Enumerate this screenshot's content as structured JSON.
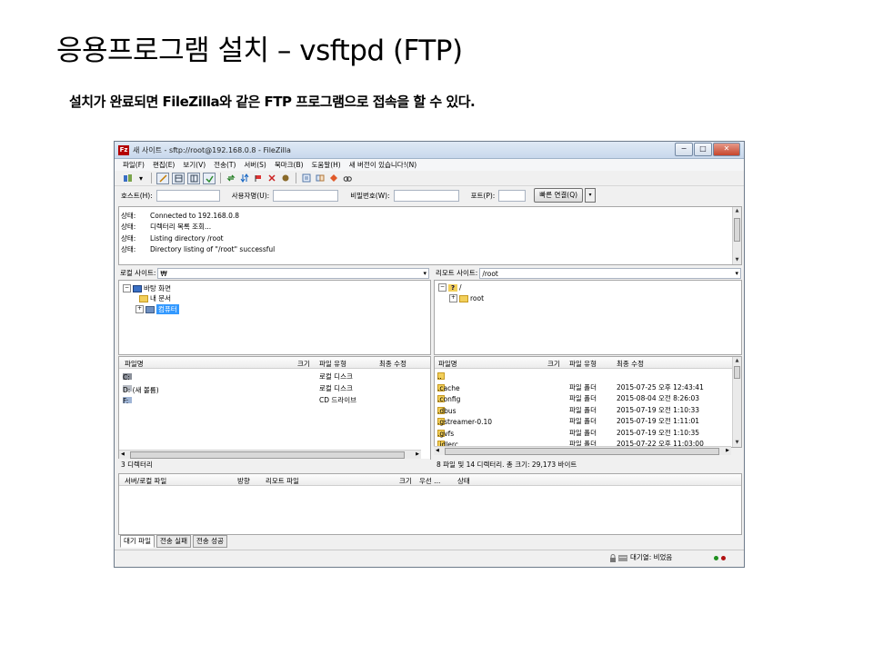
{
  "slide": {
    "title": "응용프로그램 설치 – vsftpd (FTP)",
    "subtitle": "설치가 완료되면 FileZilla와 같은 FTP 프로그램으로 접속을 할 수 있다."
  },
  "window": {
    "title": "새 사이트 - sftp://root@192.168.0.8 - FileZilla",
    "app_icon_text": "Fz",
    "btn_min": "−",
    "btn_max": "□",
    "btn_close": "✕"
  },
  "menu": [
    "파일(F)",
    "편집(E)",
    "보기(V)",
    "전송(T)",
    "서버(S)",
    "북마크(B)",
    "도움말(H)",
    "새 버전이 있습니다!(N)"
  ],
  "quickconnect": {
    "host_label": "호스트(H):",
    "user_label": "사용자명(U):",
    "pass_label": "비밀번호(W):",
    "port_label": "포트(P):",
    "connect_button": "빠른 연결(Q)",
    "dropdown_arrow": "▾"
  },
  "log": [
    {
      "k": "상태:",
      "v": "Connected to 192.168.0.8"
    },
    {
      "k": "상태:",
      "v": "디렉터리 목록 조회..."
    },
    {
      "k": "상태:",
      "v": "Listing directory /root"
    },
    {
      "k": "상태:",
      "v": "Directory listing of \"/root\" successful"
    }
  ],
  "local": {
    "site_label": "로컬 사이트:",
    "path": "₩",
    "tree": {
      "desktop": "바탕 화면",
      "mydocs": "내 문서",
      "computer": "컴퓨터"
    },
    "headers": {
      "name": "파일명",
      "size": "크기",
      "type": "파일 유형",
      "modified": "최종 수정"
    },
    "files": [
      {
        "name": "C:",
        "type": "로컬 디스크"
      },
      {
        "name": "D: (새 볼륨)",
        "type": "로컬 디스크"
      },
      {
        "name": "F:",
        "type": "CD 드라이브"
      }
    ],
    "status": "3 디렉터리"
  },
  "remote": {
    "site_label": "리모트 사이트:",
    "path": "/root",
    "tree": {
      "rootdir": "/",
      "root": "root"
    },
    "headers": {
      "name": "파일명",
      "size": "크기",
      "type": "파일 유형",
      "modified": "최종 수정"
    },
    "files": [
      {
        "name": "..",
        "type": "",
        "modified": ""
      },
      {
        "name": ".cache",
        "type": "파일 폴더",
        "modified": "2015-07-25 오후 12:43:41"
      },
      {
        "name": ".config",
        "type": "파일 폴더",
        "modified": "2015-08-04 오전 8:26:03"
      },
      {
        "name": ".dbus",
        "type": "파일 폴더",
        "modified": "2015-07-19 오전 1:10:33"
      },
      {
        "name": ".gstreamer-0.10",
        "type": "파일 폴더",
        "modified": "2015-07-19 오전 1:11:01"
      },
      {
        "name": ".gvfs",
        "type": "파일 폴더",
        "modified": "2015-07-19 오전 1:10:35"
      },
      {
        "name": ".idlerc",
        "type": "파일 폴더",
        "modified": "2015-07-22 오후 11:03:00"
      }
    ],
    "status": "8 파일 및 14 디렉터리. 총 크기: 29,173 바이트"
  },
  "queue": {
    "headers": {
      "file": "서버/로컬 파일",
      "direction": "방향",
      "remote": "리모트 파일",
      "size": "크기",
      "priority": "우선 ...",
      "status": "상태"
    }
  },
  "tabs": [
    "대기 파일",
    "전송 실패",
    "전송 성공"
  ],
  "statusbar": {
    "queue": "대기열: 비었음"
  },
  "colors": {
    "accent": "#3399ff",
    "dot_left": "#1f8f1f",
    "dot_right": "#b01010"
  }
}
